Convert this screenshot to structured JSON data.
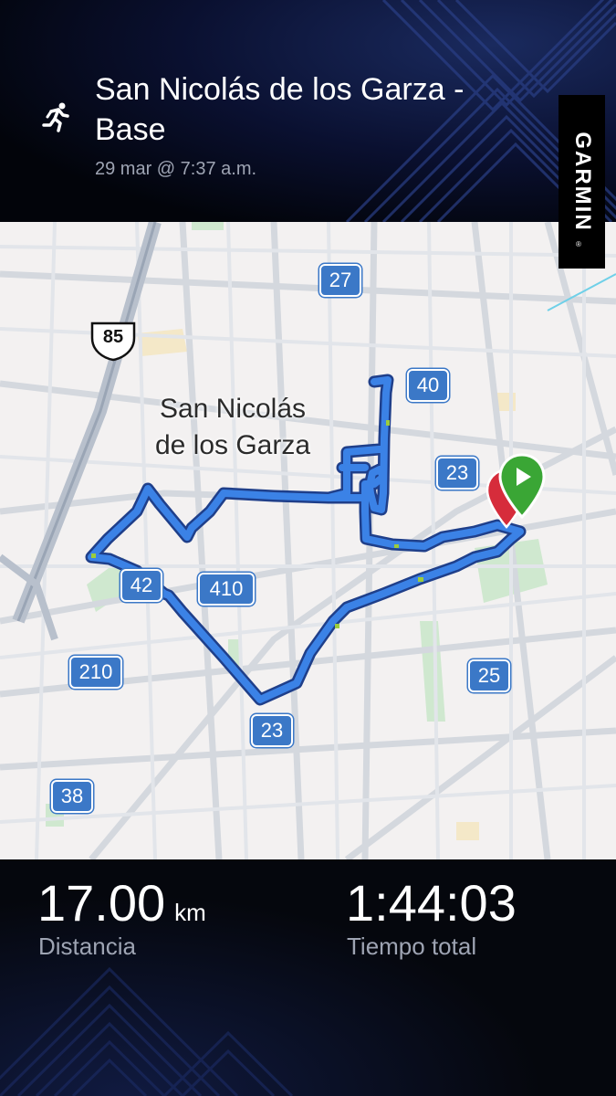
{
  "activity": {
    "icon": "running-icon",
    "title": "San Nicolás de los Garza - Base",
    "date": "29 mar @ 7:37 a.m."
  },
  "brand": {
    "name": "GARMIN",
    "reg": "®"
  },
  "map": {
    "city_label_line1": "San Nicolás",
    "city_label_line2": "de los Garza",
    "highway_shield": "85",
    "road_shields": [
      "27",
      "40",
      "23",
      "42",
      "410",
      "210",
      "25",
      "23",
      "38"
    ],
    "route_color": "#3b82e6",
    "start_marker_color": "#3aa635",
    "end_marker_color": "#d62c3b"
  },
  "stats": {
    "distance_value": "17.00",
    "distance_unit": "km",
    "distance_label": "Distancia",
    "time_value": "1:44:03",
    "time_label": "Tiempo total"
  }
}
